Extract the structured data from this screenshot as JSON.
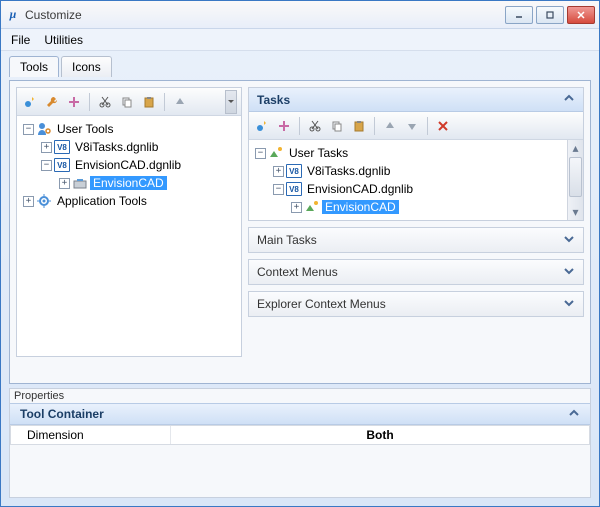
{
  "window": {
    "title": "Customize"
  },
  "menu": {
    "file": "File",
    "utilities": "Utilities"
  },
  "tabs": {
    "tools": "Tools",
    "icons": "Icons"
  },
  "left_tree": {
    "user_tools": "User Tools",
    "v8i_lib": "V8iTasks.dgnlib",
    "env_lib": "EnvisionCAD.dgnlib",
    "env_node": "EnvisionCAD",
    "app_tools": "Application Tools"
  },
  "right": {
    "tasks_header": "Tasks",
    "main_tasks": "Main Tasks",
    "context_menus": "Context Menus",
    "explorer_context_menus": "Explorer Context Menus"
  },
  "right_tree": {
    "user_tasks": "User Tasks",
    "v8i_lib": "V8iTasks.dgnlib",
    "env_lib": "EnvisionCAD.dgnlib",
    "env_node": "EnvisionCAD"
  },
  "properties": {
    "label": "Properties",
    "section": "Tool Container",
    "dimension_key": "Dimension",
    "dimension_val": "Both"
  }
}
